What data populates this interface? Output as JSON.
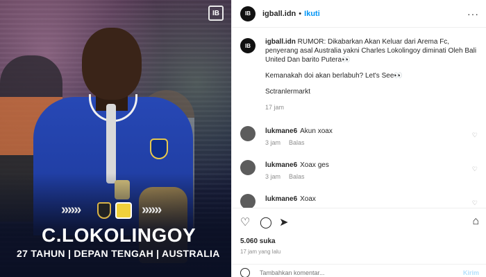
{
  "image": {
    "brand_logo_text": "IB",
    "player_name": "C.LOKOLINGOY",
    "player_info": "27 TAHUN | DEPAN TENGAH | AUSTRALIA",
    "chevrons": "»»»"
  },
  "header": {
    "avatar_text": "IB",
    "username": "igball.idn",
    "separator": "•",
    "follow_label": "Ikuti",
    "more_icon": "···"
  },
  "caption": {
    "username": "igball.idn",
    "text": "RUMOR: Dikabarkan Akan Keluar dari Arema Fc, penyerang asal Australia yakni Charles Lokolingoy diminati Oleh Bali United Dan barito Putera👀",
    "line2": "Kemanakah doi akan berlabuh? Let's See👀",
    "line3": "Sctranlermarkt",
    "time": "17 jam"
  },
  "comments": [
    {
      "username": "lukmane6",
      "text": "Akun xoax",
      "time": "3 jam",
      "reply": "Balas"
    },
    {
      "username": "lukmane6",
      "text": "Xoax ges",
      "time": "3 jam",
      "reply": "Balas"
    },
    {
      "username": "lukmane6",
      "text": "Xoax",
      "time": "",
      "reply": ""
    }
  ],
  "actions": {
    "likes": "5.060 suka",
    "time": "17 jam yang lalu",
    "comment_placeholder": "Tambahkan komentar...",
    "post_label": "Kirim"
  },
  "icons": [
    "heart-icon",
    "comment-icon",
    "share-icon",
    "bookmark-icon",
    "emoji-icon",
    "more-icon"
  ]
}
